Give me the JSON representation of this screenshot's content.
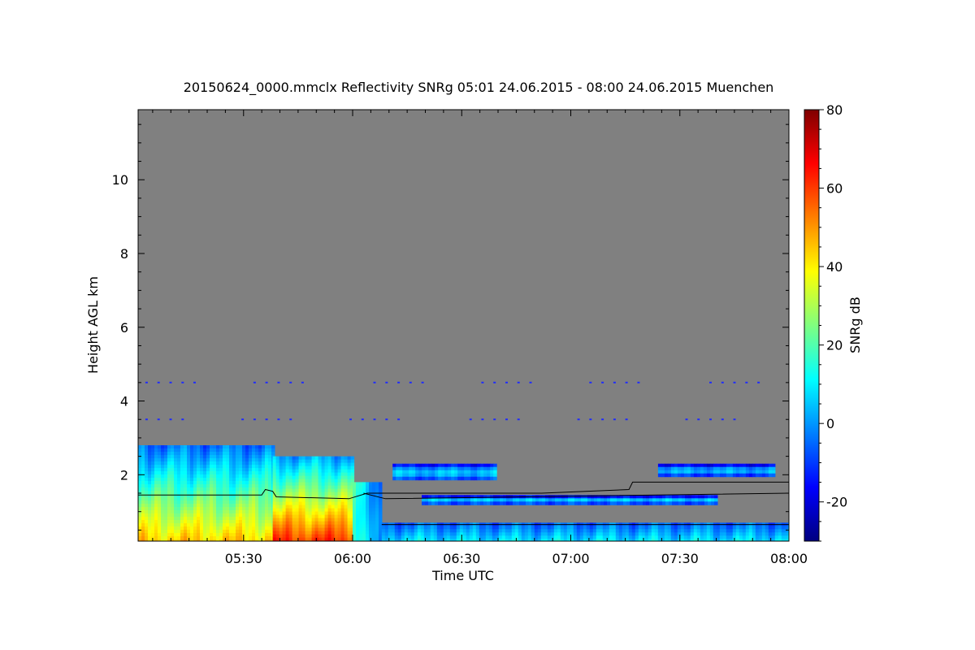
{
  "chart_data": {
    "type": "heatmap",
    "title": "20150624_0000.mmclx Reflectivity SNRg   05:01 24.06.2015 - 08:00 24.06.2015 Muenchen",
    "xlabel": "Time UTC",
    "ylabel": "Height AGL km",
    "colorbar_label": "SNRg dB",
    "xlim_utc": [
      "05:01",
      "08:00"
    ],
    "ylim_km": [
      0.2,
      11.9
    ],
    "zlim_db": [
      -30,
      80
    ],
    "x_ticks": [
      {
        "value_min": 30,
        "label": "05:30"
      },
      {
        "value_min": 60,
        "label": "06:00"
      },
      {
        "value_min": 90,
        "label": "06:30"
      },
      {
        "value_min": 120,
        "label": "07:00"
      },
      {
        "value_min": 150,
        "label": "07:30"
      },
      {
        "value_min": 180,
        "label": "08:00"
      }
    ],
    "y_ticks": [
      {
        "value": 2,
        "label": "2"
      },
      {
        "value": 4,
        "label": "4"
      },
      {
        "value": 6,
        "label": "6"
      },
      {
        "value": 8,
        "label": "8"
      },
      {
        "value": 10,
        "label": "10"
      }
    ],
    "colorbar_ticks": [
      {
        "value": 80,
        "label": "80"
      },
      {
        "value": 60,
        "label": "60"
      },
      {
        "value": 40,
        "label": "40"
      },
      {
        "value": 20,
        "label": "20"
      },
      {
        "value": 0,
        "label": "0"
      },
      {
        "value": -20,
        "label": "-20"
      }
    ],
    "colormap": "jet",
    "background_color": "#808080",
    "regions": [
      {
        "desc": "rain",
        "t0": 1,
        "t1": 38,
        "h0": 0.2,
        "h1": 2.8,
        "peak_db": 45
      },
      {
        "desc": "heavy rain",
        "t0": 38,
        "t1": 60,
        "h0": 0.2,
        "h1": 2.5,
        "peak_db": 62
      },
      {
        "desc": "trailing rain",
        "t0": 60,
        "t1": 68,
        "h0": 0.2,
        "h1": 1.8,
        "peak_db": 20
      },
      {
        "desc": "cloud layer",
        "t0": 71,
        "t1": 99,
        "h0": 1.9,
        "h1": 2.3,
        "peak_db": 5
      },
      {
        "desc": "cloud layer",
        "t0": 79,
        "t1": 160,
        "h0": 1.25,
        "h1": 1.45,
        "peak_db": 5
      },
      {
        "desc": "cloud layer",
        "t0": 144,
        "t1": 176,
        "h0": 2.0,
        "h1": 2.3,
        "peak_db": 3
      },
      {
        "desc": "near-surface echo",
        "t0": 68,
        "t1": 180,
        "h0": 0.2,
        "h1": 0.7,
        "peak_db": 10
      }
    ],
    "overlay_line": [
      {
        "t": 1,
        "h": 1.45
      },
      {
        "t": 35,
        "h": 1.45
      },
      {
        "t": 36,
        "h": 1.6
      },
      {
        "t": 38,
        "h": 1.55
      },
      {
        "t": 39,
        "h": 1.4
      },
      {
        "t": 59,
        "h": 1.35
      },
      {
        "t": 64,
        "h": 1.5
      },
      {
        "t": 112,
        "h": 1.5
      },
      {
        "t": 136,
        "h": 1.6
      },
      {
        "t": 137,
        "h": 1.8
      },
      {
        "t": 180,
        "h": 1.8
      }
    ],
    "overlay_line2": [
      {
        "t": 63,
        "h": 1.5
      },
      {
        "t": 69,
        "h": 1.35
      },
      {
        "t": 180,
        "h": 1.5
      }
    ],
    "overlay_line3": [
      {
        "t": 68,
        "h": 0.65
      },
      {
        "t": 180,
        "h": 0.65
      }
    ]
  }
}
